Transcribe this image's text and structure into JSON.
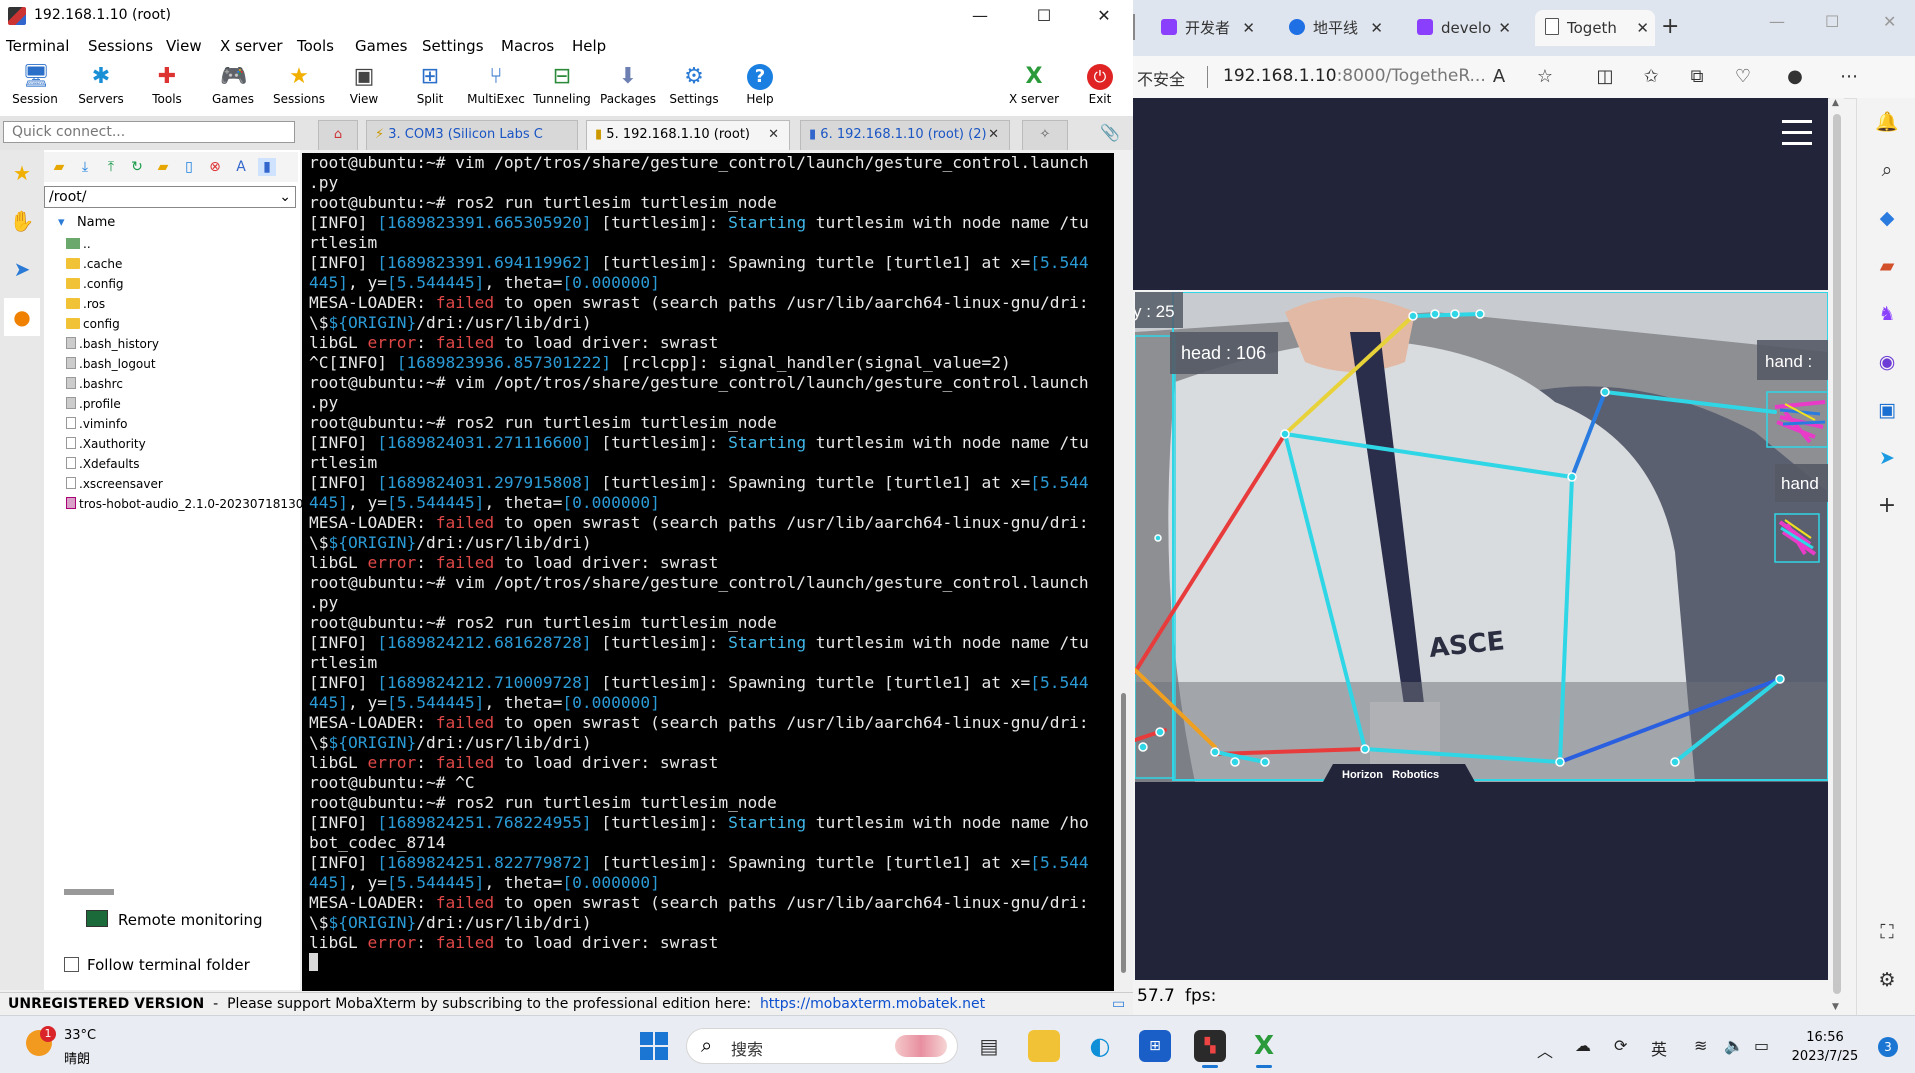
{
  "moba": {
    "title": "192.168.1.10 (root)",
    "menu": [
      "Terminal",
      "Sessions",
      "View",
      "X server",
      "Tools",
      "Games",
      "Settings",
      "Macros",
      "Help"
    ],
    "toolbar": [
      "Session",
      "Servers",
      "Tools",
      "Games",
      "Sessions",
      "View",
      "Split",
      "MultiExec",
      "Tunneling",
      "Packages",
      "Settings",
      "Help"
    ],
    "toolbar_right": [
      "X server",
      "Exit"
    ],
    "quick_connect_placeholder": "Quick connect...",
    "tabs": [
      {
        "label": "3. COM3  (Silicon Labs C"
      },
      {
        "label": "5. 192.168.1.10 (root)"
      },
      {
        "label": "6. 192.168.1.10 (root) (2)"
      }
    ],
    "path": "/root/",
    "name_header": "Name",
    "files": [
      "..",
      ".cache",
      ".config",
      ".ros",
      "config",
      ".bash_history",
      ".bash_logout",
      ".bashrc",
      ".profile",
      ".viminfo",
      ".Xauthority",
      ".Xdefaults",
      ".xscreensaver",
      "tros-hobot-audio_2.1.0-20230718130"
    ],
    "remote_monitoring": "Remote monitoring",
    "follow_terminal_folder": "Follow terminal folder",
    "status_unregistered": "UNREGISTERED VERSION",
    "status_message": "  -  Please support MobaXterm by subscribing to the professional edition here:  ",
    "status_link": "https://mobaxterm.mobatek.net"
  },
  "terminal": {
    "lines": [
      [
        {
          "t": "root@ubuntu:~# vim /opt/tros/share/gesture_control/launch/gesture_control.launch"
        }
      ],
      [
        {
          "t": ".py"
        }
      ],
      [
        {
          "t": "root@ubuntu:~# ros2 run turtlesim turtlesim_node"
        }
      ],
      [
        {
          "t": "[INFO] "
        },
        {
          "t": "[1689823391.665305920]",
          "c": "blue"
        },
        {
          "t": " [turtlesim]: "
        },
        {
          "t": "Starting",
          "c": "cyan"
        },
        {
          "t": " turtlesim with node name /tu"
        }
      ],
      [
        {
          "t": "rtlesim"
        }
      ],
      [
        {
          "t": "[INFO] "
        },
        {
          "t": "[1689823391.694119962]",
          "c": "blue"
        },
        {
          "t": " [turtlesim]: Spawning turtle [turtle1] at x="
        },
        {
          "t": "[5.544",
          "c": "blue"
        }
      ],
      [
        {
          "t": "445]",
          "c": "blue"
        },
        {
          "t": ", y="
        },
        {
          "t": "[5.544445]",
          "c": "blue"
        },
        {
          "t": ", theta="
        },
        {
          "t": "[0.000000]",
          "c": "blue"
        }
      ],
      [
        {
          "t": "MESA-LOADER: "
        },
        {
          "t": "failed",
          "c": "red"
        },
        {
          "t": " to open swrast (search paths /usr/lib/aarch64-linux-gnu/dri:"
        }
      ],
      [
        {
          "t": "\\$"
        },
        {
          "t": "${ORIGIN}",
          "c": "blue"
        },
        {
          "t": "/dri:/usr/lib/dri)"
        }
      ],
      [
        {
          "t": "libGL "
        },
        {
          "t": "error",
          "c": "red"
        },
        {
          "t": ": "
        },
        {
          "t": "failed",
          "c": "red"
        },
        {
          "t": " to load driver: swrast"
        }
      ],
      [
        {
          "t": "^C[INFO] "
        },
        {
          "t": "[1689823936.857301222]",
          "c": "blue"
        },
        {
          "t": " [rclcpp]: signal_handler(signal_value=2)"
        }
      ],
      [
        {
          "t": "root@ubuntu:~# vim /opt/tros/share/gesture_control/launch/gesture_control.launch"
        }
      ],
      [
        {
          "t": ".py"
        }
      ],
      [
        {
          "t": "root@ubuntu:~# ros2 run turtlesim turtlesim_node"
        }
      ],
      [
        {
          "t": "[INFO] "
        },
        {
          "t": "[1689824031.271116600]",
          "c": "blue"
        },
        {
          "t": " [turtlesim]: "
        },
        {
          "t": "Starting",
          "c": "cyan"
        },
        {
          "t": " turtlesim with node name /tu"
        }
      ],
      [
        {
          "t": "rtlesim"
        }
      ],
      [
        {
          "t": "[INFO] "
        },
        {
          "t": "[1689824031.297915808]",
          "c": "blue"
        },
        {
          "t": " [turtlesim]: Spawning turtle [turtle1] at x="
        },
        {
          "t": "[5.544",
          "c": "blue"
        }
      ],
      [
        {
          "t": "445]",
          "c": "blue"
        },
        {
          "t": ", y="
        },
        {
          "t": "[5.544445]",
          "c": "blue"
        },
        {
          "t": ", theta="
        },
        {
          "t": "[0.000000]",
          "c": "blue"
        }
      ],
      [
        {
          "t": "MESA-LOADER: "
        },
        {
          "t": "failed",
          "c": "red"
        },
        {
          "t": " to open swrast (search paths /usr/lib/aarch64-linux-gnu/dri:"
        }
      ],
      [
        {
          "t": "\\$"
        },
        {
          "t": "${ORIGIN}",
          "c": "blue"
        },
        {
          "t": "/dri:/usr/lib/dri)"
        }
      ],
      [
        {
          "t": "libGL "
        },
        {
          "t": "error",
          "c": "red"
        },
        {
          "t": ": "
        },
        {
          "t": "failed",
          "c": "red"
        },
        {
          "t": " to load driver: swrast"
        }
      ],
      [
        {
          "t": "root@ubuntu:~# vim /opt/tros/share/gesture_control/launch/gesture_control.launch"
        }
      ],
      [
        {
          "t": ".py"
        }
      ],
      [
        {
          "t": "root@ubuntu:~# ros2 run turtlesim turtlesim_node"
        }
      ],
      [
        {
          "t": "[INFO] "
        },
        {
          "t": "[1689824212.681628728]",
          "c": "blue"
        },
        {
          "t": " [turtlesim]: "
        },
        {
          "t": "Starting",
          "c": "cyan"
        },
        {
          "t": " turtlesim with node name /tu"
        }
      ],
      [
        {
          "t": "rtlesim"
        }
      ],
      [
        {
          "t": "[INFO] "
        },
        {
          "t": "[1689824212.710009728]",
          "c": "blue"
        },
        {
          "t": " [turtlesim]: Spawning turtle [turtle1] at x="
        },
        {
          "t": "[5.544",
          "c": "blue"
        }
      ],
      [
        {
          "t": "445]",
          "c": "blue"
        },
        {
          "t": ", y="
        },
        {
          "t": "[5.544445]",
          "c": "blue"
        },
        {
          "t": ", theta="
        },
        {
          "t": "[0.000000]",
          "c": "blue"
        }
      ],
      [
        {
          "t": "MESA-LOADER: "
        },
        {
          "t": "failed",
          "c": "red"
        },
        {
          "t": " to open swrast (search paths /usr/lib/aarch64-linux-gnu/dri:"
        }
      ],
      [
        {
          "t": "\\$"
        },
        {
          "t": "${ORIGIN}",
          "c": "blue"
        },
        {
          "t": "/dri:/usr/lib/dri)"
        }
      ],
      [
        {
          "t": "libGL "
        },
        {
          "t": "error",
          "c": "red"
        },
        {
          "t": ": "
        },
        {
          "t": "failed",
          "c": "red"
        },
        {
          "t": " to load driver: swrast"
        }
      ],
      [
        {
          "t": "root@ubuntu:~# ^C"
        }
      ],
      [
        {
          "t": "root@ubuntu:~# ros2 run turtlesim turtlesim_node"
        }
      ],
      [
        {
          "t": "[INFO] "
        },
        {
          "t": "[1689824251.768224955]",
          "c": "blue"
        },
        {
          "t": " [turtlesim]: "
        },
        {
          "t": "Starting",
          "c": "cyan"
        },
        {
          "t": " turtlesim with node name /ho"
        }
      ],
      [
        {
          "t": "bot_codec_8714"
        }
      ],
      [
        {
          "t": "[INFO] "
        },
        {
          "t": "[1689824251.822779872]",
          "c": "blue"
        },
        {
          "t": " [turtlesim]: Spawning turtle [turtle1] at x="
        },
        {
          "t": "[5.544",
          "c": "blue"
        }
      ],
      [
        {
          "t": "445]",
          "c": "blue"
        },
        {
          "t": ", y="
        },
        {
          "t": "[5.544445]",
          "c": "blue"
        },
        {
          "t": ", theta="
        },
        {
          "t": "[0.000000]",
          "c": "blue"
        }
      ],
      [
        {
          "t": "MESA-LOADER: "
        },
        {
          "t": "failed",
          "c": "red"
        },
        {
          "t": " to open swrast (search paths /usr/lib/aarch64-linux-gnu/dri:"
        }
      ],
      [
        {
          "t": "\\$"
        },
        {
          "t": "${ORIGIN}",
          "c": "blue"
        },
        {
          "t": "/dri:/usr/lib/dri)"
        }
      ],
      [
        {
          "t": "libGL "
        },
        {
          "t": "error",
          "c": "red"
        },
        {
          "t": ": "
        },
        {
          "t": "failed",
          "c": "red"
        },
        {
          "t": " to load driver: swrast"
        }
      ]
    ]
  },
  "browser": {
    "tabs": [
      {
        "label": "开发者",
        "favicon": "#8a3ffc"
      },
      {
        "label": "地平线",
        "favicon": "#1f6fe5"
      },
      {
        "label": "develo",
        "favicon": "#8a3ffc"
      },
      {
        "label": "Togeth",
        "favicon": "#ffffff"
      }
    ],
    "insecure_label": "不安全",
    "url_host": "192.168.1.10",
    "url_rest": ":8000/TogetheR...",
    "overlay": {
      "y_label": "y : 25",
      "head_label": "head : 106",
      "hand_label_1": "hand :",
      "hand_label_2": "hand",
      "watermark": "Horizon   Robotics",
      "shirt_text": "ASCE"
    },
    "fps_value": "57.7",
    "fps_label": "fps:"
  },
  "taskbar": {
    "temp": "33°C",
    "weather": "晴朗",
    "weather_badge": "1",
    "search_label": "搜索",
    "ime": "英",
    "time": "16:56",
    "date": "2023/7/25",
    "notifications": "3"
  },
  "colors": {
    "terminal_bg": "#000000",
    "term_blue": "#2a9bd6",
    "term_red": "#e04848",
    "page_header": "#22253a",
    "skeleton_cyan": "#2fd6e6"
  }
}
